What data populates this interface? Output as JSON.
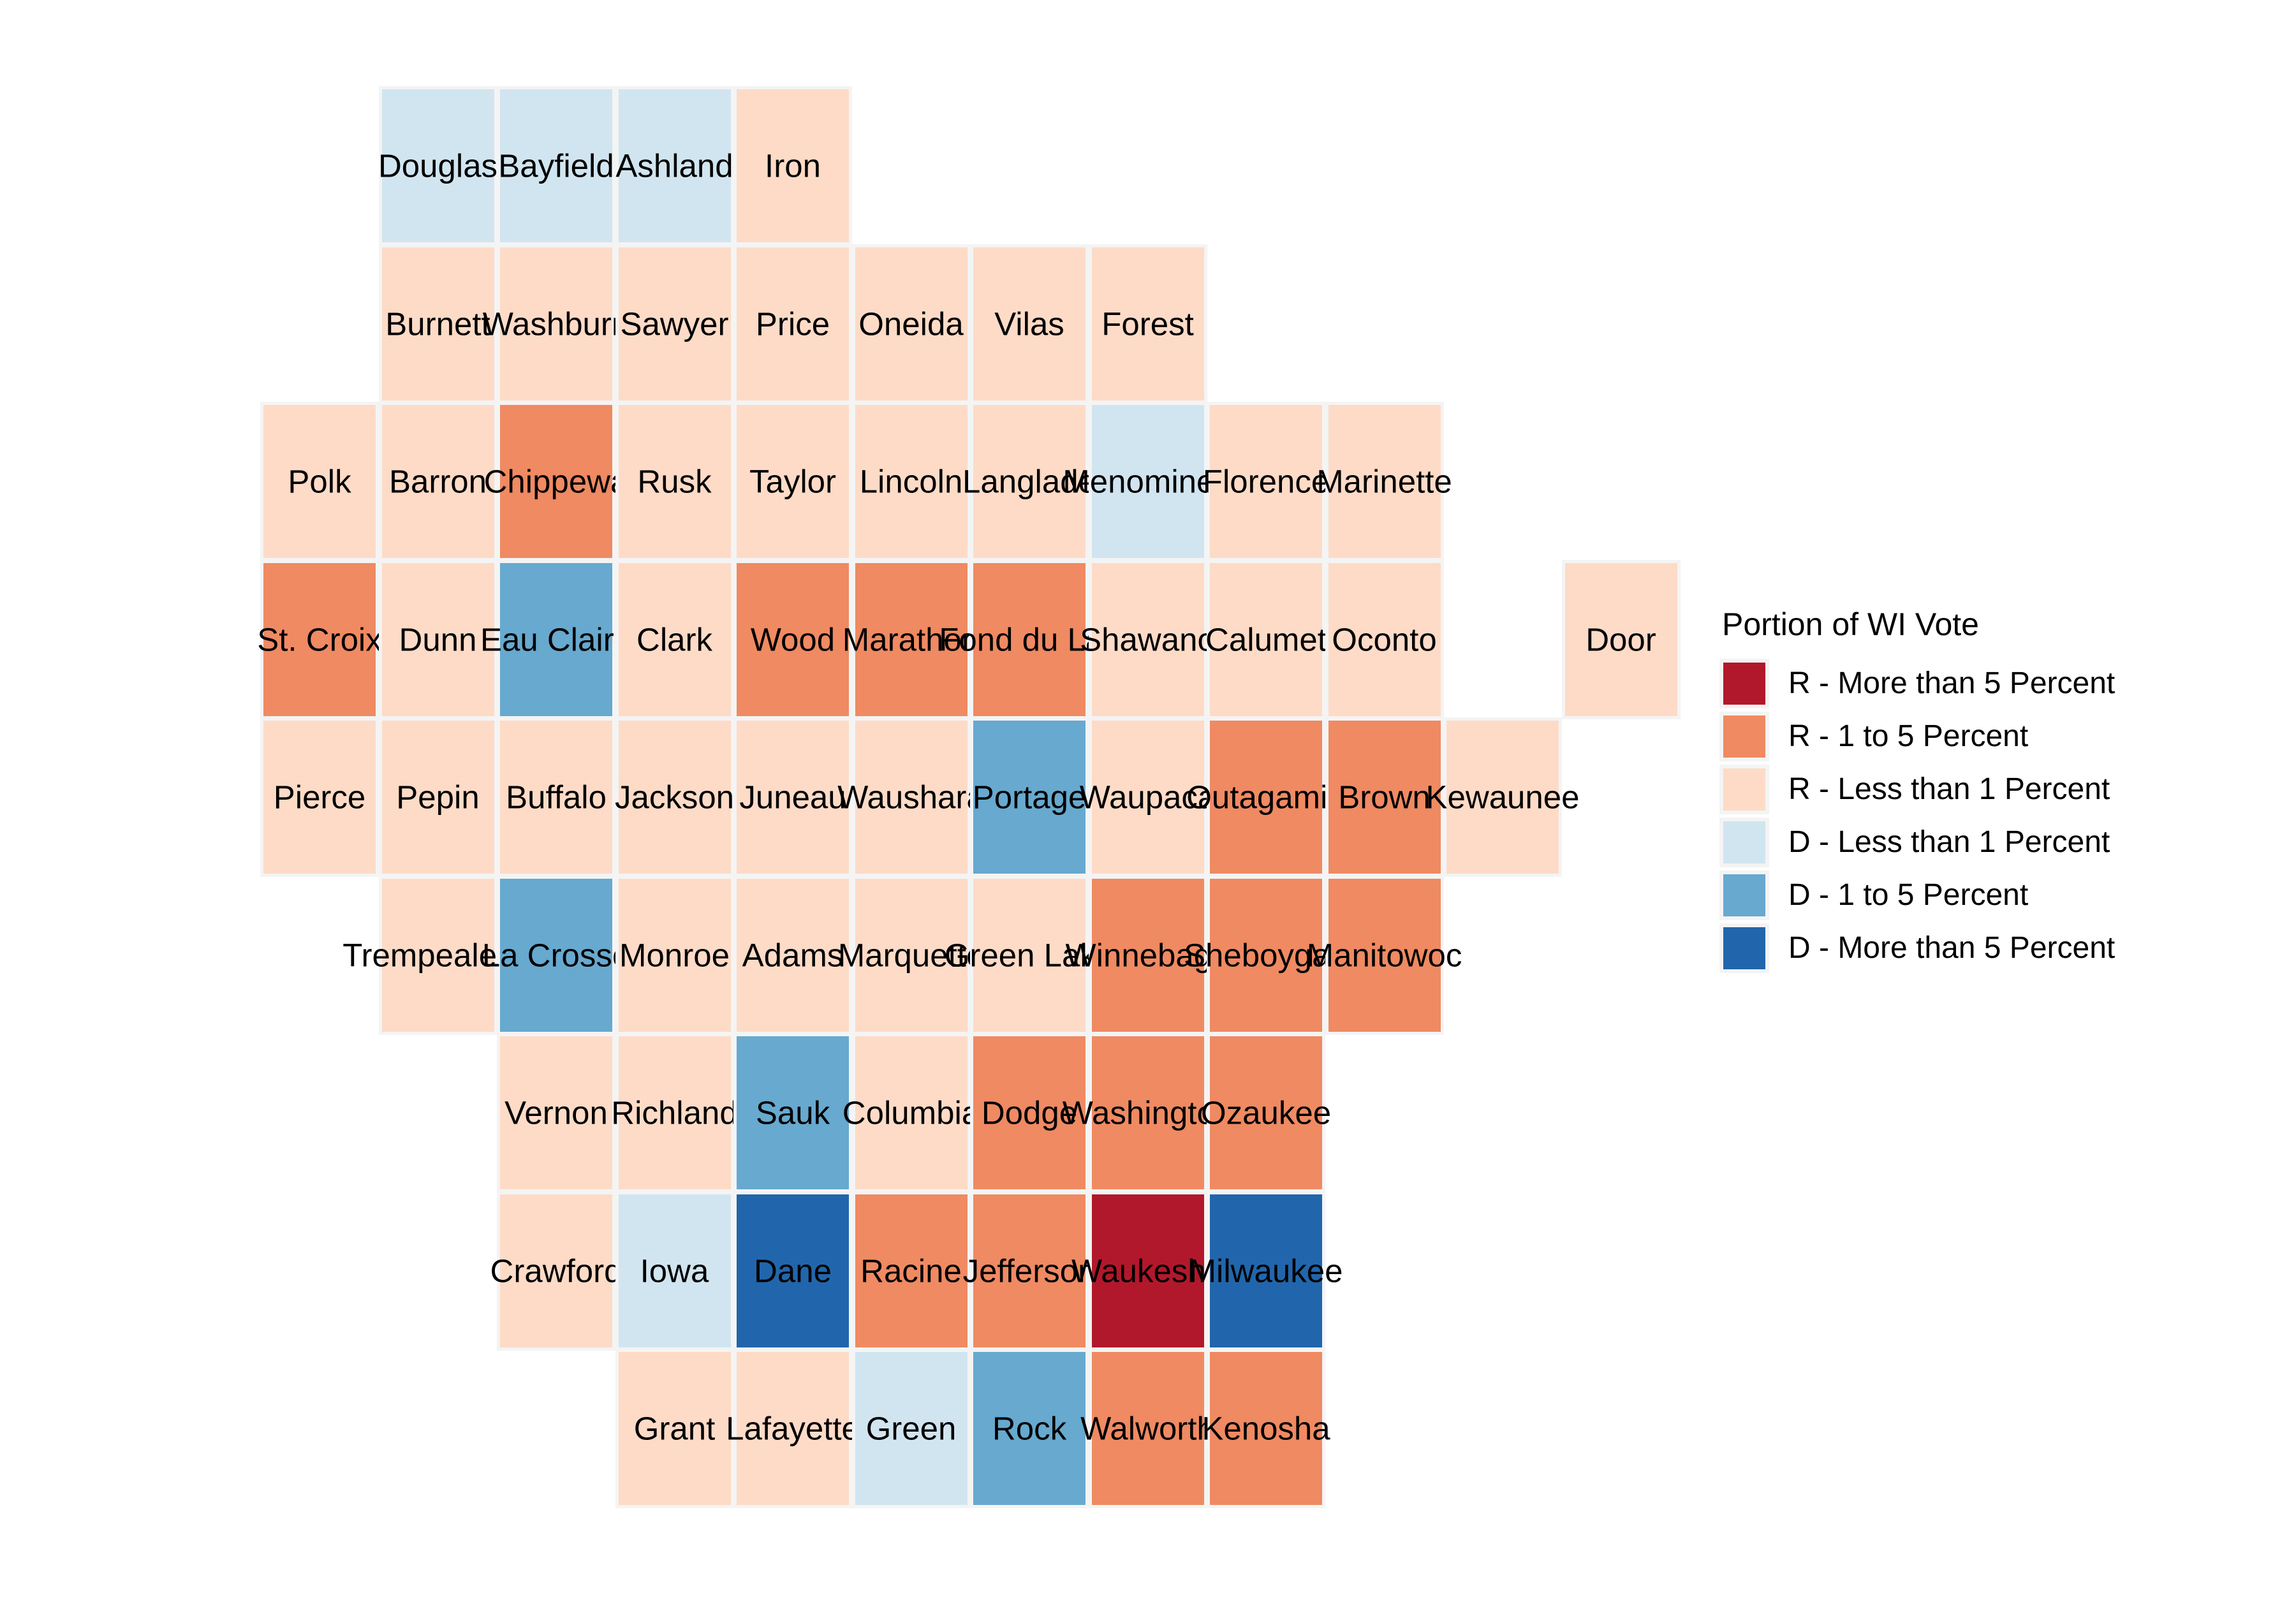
{
  "legend": {
    "title": "Portion of WI Vote",
    "items": [
      {
        "label": "R - More than 5 Percent",
        "color": "#b2182b"
      },
      {
        "label": "R - 1 to 5 Percent",
        "color": "#ef8a62"
      },
      {
        "label": "R - Less than 1 Percent",
        "color": "#fddbc7"
      },
      {
        "label": "D - Less than 1 Percent",
        "color": "#d1e5f0"
      },
      {
        "label": "D - 1 to 5 Percent",
        "color": "#67a9cf"
      },
      {
        "label": "D - More than 5 Percent",
        "color": "#2166ac"
      }
    ]
  },
  "palette": {
    "r_more_than_5": "#b2182b",
    "r_1_to_5": "#ef8a62",
    "r_less_than_1": "#fddbc7",
    "d_less_than_1": "#d1e5f0",
    "d_1_to_5": "#67a9cf",
    "d_more_than_5": "#2166ac",
    "panel_gap": "#f4f4f4",
    "background": "#ffffff"
  },
  "chart_data": {
    "type": "heatmap",
    "title": "",
    "xlabel": "",
    "ylabel": "",
    "grid": false,
    "legend_position": "right",
    "grid_columns": 12,
    "grid_rows": 9,
    "category_order": [
      "R - More than 5 Percent",
      "R - 1 to 5 Percent",
      "R - Less than 1 Percent",
      "D - Less than 1 Percent",
      "D - 1 to 5 Percent",
      "D - More than 5 Percent"
    ],
    "tiles": [
      {
        "name": "Douglas",
        "row": 0,
        "col": 1,
        "category": "D - Less than 1 Percent"
      },
      {
        "name": "Bayfield",
        "row": 0,
        "col": 2,
        "category": "D - Less than 1 Percent"
      },
      {
        "name": "Ashland",
        "row": 0,
        "col": 3,
        "category": "D - Less than 1 Percent"
      },
      {
        "name": "Iron",
        "row": 0,
        "col": 4,
        "category": "R - Less than 1 Percent"
      },
      {
        "name": "Burnett",
        "row": 1,
        "col": 1,
        "category": "R - Less than 1 Percent"
      },
      {
        "name": "Washburn",
        "row": 1,
        "col": 2,
        "category": "R - Less than 1 Percent"
      },
      {
        "name": "Sawyer",
        "row": 1,
        "col": 3,
        "category": "R - Less than 1 Percent"
      },
      {
        "name": "Price",
        "row": 1,
        "col": 4,
        "category": "R - Less than 1 Percent"
      },
      {
        "name": "Oneida",
        "row": 1,
        "col": 5,
        "category": "R - Less than 1 Percent"
      },
      {
        "name": "Vilas",
        "row": 1,
        "col": 6,
        "category": "R - Less than 1 Percent"
      },
      {
        "name": "Forest",
        "row": 1,
        "col": 7,
        "category": "R - Less than 1 Percent"
      },
      {
        "name": "Polk",
        "row": 2,
        "col": 0,
        "category": "R - Less than 1 Percent"
      },
      {
        "name": "Barron",
        "row": 2,
        "col": 1,
        "category": "R - Less than 1 Percent"
      },
      {
        "name": "Chippewa",
        "row": 2,
        "col": 2,
        "category": "R - 1 to 5 Percent"
      },
      {
        "name": "Rusk",
        "row": 2,
        "col": 3,
        "category": "R - Less than 1 Percent"
      },
      {
        "name": "Taylor",
        "row": 2,
        "col": 4,
        "category": "R - Less than 1 Percent"
      },
      {
        "name": "Lincoln",
        "row": 2,
        "col": 5,
        "category": "R - Less than 1 Percent"
      },
      {
        "name": "Langlade",
        "row": 2,
        "col": 6,
        "category": "R - Less than 1 Percent"
      },
      {
        "name": "Menominee",
        "row": 2,
        "col": 7,
        "category": "D - Less than 1 Percent"
      },
      {
        "name": "Florence",
        "row": 2,
        "col": 8,
        "category": "R - Less than 1 Percent"
      },
      {
        "name": "Marinette",
        "row": 2,
        "col": 9,
        "category": "R - Less than 1 Percent"
      },
      {
        "name": "St. Croix",
        "row": 3,
        "col": 0,
        "category": "R - 1 to 5 Percent"
      },
      {
        "name": "Dunn",
        "row": 3,
        "col": 1,
        "category": "R - Less than 1 Percent"
      },
      {
        "name": "Eau Claire",
        "row": 3,
        "col": 2,
        "category": "D - 1 to 5 Percent"
      },
      {
        "name": "Clark",
        "row": 3,
        "col": 3,
        "category": "R - Less than 1 Percent"
      },
      {
        "name": "Wood",
        "row": 3,
        "col": 4,
        "category": "R - 1 to 5 Percent"
      },
      {
        "name": "Marathon",
        "row": 3,
        "col": 5,
        "category": "R - 1 to 5 Percent"
      },
      {
        "name": "Fond du Lac",
        "row": 3,
        "col": 6,
        "category": "R - 1 to 5 Percent"
      },
      {
        "name": "Shawano",
        "row": 3,
        "col": 7,
        "category": "R - Less than 1 Percent"
      },
      {
        "name": "Calumet",
        "row": 3,
        "col": 8,
        "category": "R - Less than 1 Percent"
      },
      {
        "name": "Oconto",
        "row": 3,
        "col": 9,
        "category": "R - Less than 1 Percent"
      },
      {
        "name": "Door",
        "row": 3,
        "col": 11,
        "category": "R - Less than 1 Percent"
      },
      {
        "name": "Pierce",
        "row": 4,
        "col": 0,
        "category": "R - Less than 1 Percent"
      },
      {
        "name": "Pepin",
        "row": 4,
        "col": 1,
        "category": "R - Less than 1 Percent"
      },
      {
        "name": "Buffalo",
        "row": 4,
        "col": 2,
        "category": "R - Less than 1 Percent"
      },
      {
        "name": "Jackson",
        "row": 4,
        "col": 3,
        "category": "R - Less than 1 Percent"
      },
      {
        "name": "Juneau",
        "row": 4,
        "col": 4,
        "category": "R - Less than 1 Percent"
      },
      {
        "name": "Waushara",
        "row": 4,
        "col": 5,
        "category": "R - Less than 1 Percent"
      },
      {
        "name": "Portage",
        "row": 4,
        "col": 6,
        "category": "D - 1 to 5 Percent"
      },
      {
        "name": "Waupaca",
        "row": 4,
        "col": 7,
        "category": "R - Less than 1 Percent"
      },
      {
        "name": "Outagamie",
        "row": 4,
        "col": 8,
        "category": "R - 1 to 5 Percent"
      },
      {
        "name": "Brown",
        "row": 4,
        "col": 9,
        "category": "R - 1 to 5 Percent"
      },
      {
        "name": "Kewaunee",
        "row": 4,
        "col": 10,
        "category": "R - Less than 1 Percent"
      },
      {
        "name": "Trempealeau",
        "row": 5,
        "col": 1,
        "category": "R - Less than 1 Percent"
      },
      {
        "name": "La Crosse",
        "row": 5,
        "col": 2,
        "category": "D - 1 to 5 Percent"
      },
      {
        "name": "Monroe",
        "row": 5,
        "col": 3,
        "category": "R - Less than 1 Percent"
      },
      {
        "name": "Adams",
        "row": 5,
        "col": 4,
        "category": "R - Less than 1 Percent"
      },
      {
        "name": "Marquette",
        "row": 5,
        "col": 5,
        "category": "R - Less than 1 Percent"
      },
      {
        "name": "Green Lake",
        "row": 5,
        "col": 6,
        "category": "R - Less than 1 Percent"
      },
      {
        "name": "Winnebago",
        "row": 5,
        "col": 7,
        "category": "R - 1 to 5 Percent"
      },
      {
        "name": "Sheboygan",
        "row": 5,
        "col": 8,
        "category": "R - 1 to 5 Percent"
      },
      {
        "name": "Manitowoc",
        "row": 5,
        "col": 9,
        "category": "R - 1 to 5 Percent"
      },
      {
        "name": "Vernon",
        "row": 6,
        "col": 2,
        "category": "R - Less than 1 Percent"
      },
      {
        "name": "Richland",
        "row": 6,
        "col": 3,
        "category": "R - Less than 1 Percent"
      },
      {
        "name": "Sauk",
        "row": 6,
        "col": 4,
        "category": "D - 1 to 5 Percent"
      },
      {
        "name": "Columbia",
        "row": 6,
        "col": 5,
        "category": "R - Less than 1 Percent"
      },
      {
        "name": "Dodge",
        "row": 6,
        "col": 6,
        "category": "R - 1 to 5 Percent"
      },
      {
        "name": "Washington",
        "row": 6,
        "col": 7,
        "category": "R - 1 to 5 Percent"
      },
      {
        "name": "Ozaukee",
        "row": 6,
        "col": 8,
        "category": "R - 1 to 5 Percent"
      },
      {
        "name": "Crawford",
        "row": 7,
        "col": 2,
        "category": "R - Less than 1 Percent"
      },
      {
        "name": "Iowa",
        "row": 7,
        "col": 3,
        "category": "D - Less than 1 Percent"
      },
      {
        "name": "Dane",
        "row": 7,
        "col": 4,
        "category": "D - More than 5 Percent"
      },
      {
        "name": "Racine",
        "row": 7,
        "col": 5,
        "category": "R - 1 to 5 Percent"
      },
      {
        "name": "Jefferson",
        "row": 7,
        "col": 6,
        "category": "R - 1 to 5 Percent"
      },
      {
        "name": "Waukesha",
        "row": 7,
        "col": 7,
        "category": "R - More than 5 Percent"
      },
      {
        "name": "Milwaukee",
        "row": 7,
        "col": 8,
        "category": "D - More than 5 Percent"
      },
      {
        "name": "Grant",
        "row": 8,
        "col": 3,
        "category": "R - Less than 1 Percent"
      },
      {
        "name": "Lafayette",
        "row": 8,
        "col": 4,
        "category": "R - Less than 1 Percent"
      },
      {
        "name": "Green",
        "row": 8,
        "col": 5,
        "category": "D - Less than 1 Percent"
      },
      {
        "name": "Rock",
        "row": 8,
        "col": 6,
        "category": "D - 1 to 5 Percent"
      },
      {
        "name": "Walworth",
        "row": 8,
        "col": 7,
        "category": "R - 1 to 5 Percent"
      },
      {
        "name": "Kenosha",
        "row": 8,
        "col": 8,
        "category": "R - 1 to 5 Percent"
      }
    ]
  }
}
